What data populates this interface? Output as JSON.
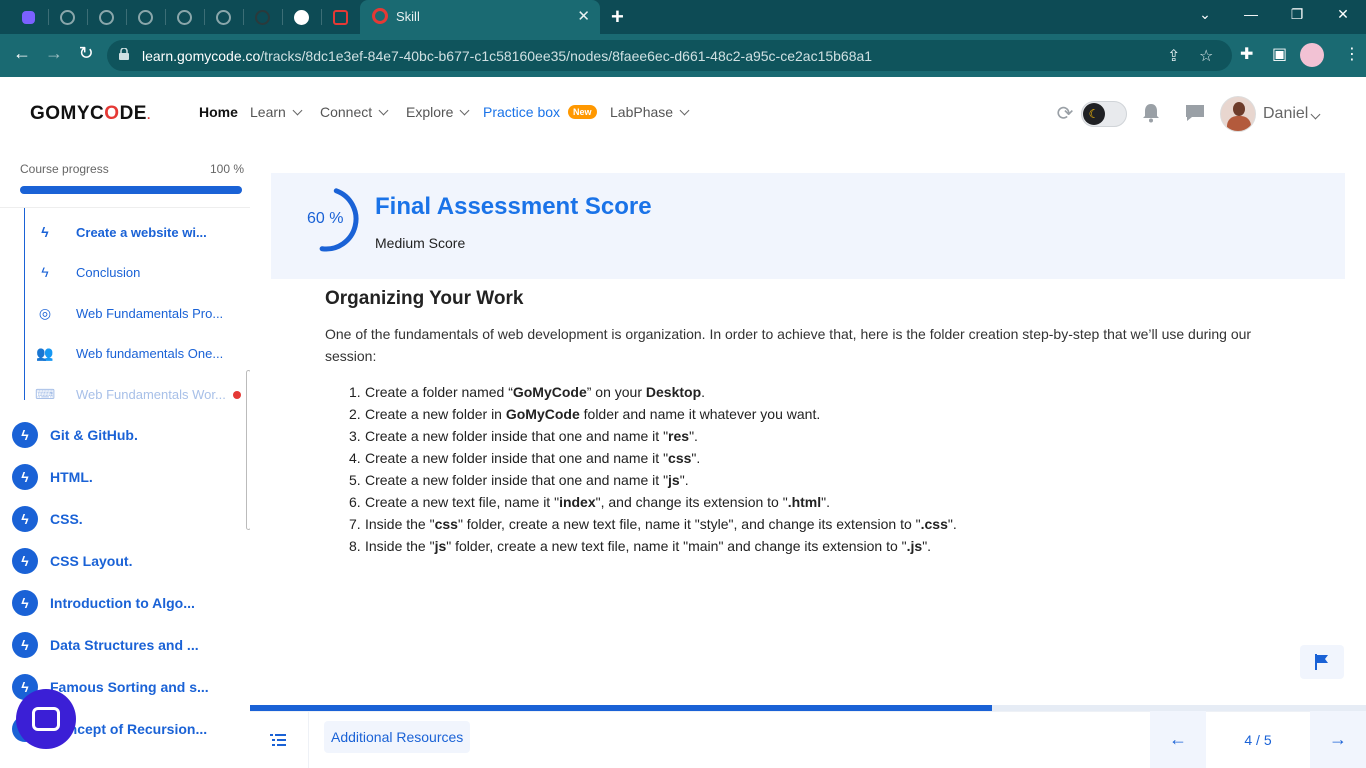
{
  "browser": {
    "tab_title": "Skill",
    "url_domain": "learn.gomycode.co",
    "url_path": "/tracks/8dc1e3ef-84e7-40bc-b677-c1c58160ee35/nodes/8faee6ec-d661-48c2-a95c-ce2ac15b68a1"
  },
  "header": {
    "logo_left": "GOMYC",
    "logo_mid": "O",
    "logo_right": "DE",
    "logo_mark": ".",
    "nav": {
      "home": "Home",
      "learn": "Learn",
      "connect": "Connect",
      "explore": "Explore",
      "practice": "Practice box",
      "practice_badge": "New",
      "labphase": "LabPhase"
    },
    "user_name": "Daniel"
  },
  "sidebar": {
    "progress_label": "Course progress",
    "progress_value": "100 %",
    "progress_fraction": 1.0,
    "sub_items": [
      {
        "label": "Create a website wi...",
        "icon": "lightning-icon"
      },
      {
        "label": "Conclusion",
        "icon": "lightning-icon"
      },
      {
        "label": "Web Fundamentals Pro...",
        "icon": "target-icon"
      },
      {
        "label": "Web fundamentals One...",
        "icon": "people-icon"
      },
      {
        "label": "Web Fundamentals Wor...",
        "icon": "workshop-icon"
      }
    ],
    "modules": [
      "Git & GitHub.",
      "HTML.",
      "CSS.",
      "CSS Layout.",
      "Introduction to Algo...",
      "Data Structures and ...",
      "Famous Sorting and s...",
      "Concept of Recursion..."
    ]
  },
  "score": {
    "percent_label": "60 %",
    "percent": 60,
    "title": "Final Assessment Score",
    "subtitle": "Medium Score"
  },
  "lesson": {
    "title": "Organizing Your Work",
    "intro": "One of the fundamentals of web development is organization. In order to achieve that, here is the folder creation step-by-step that we’ll use during our session:",
    "steps": [
      {
        "n": "1.",
        "a": "Create a folder named “",
        "b": "GoMyCode",
        "c": "” on your ",
        "d": "Desktop",
        "e": "."
      },
      {
        "n": "2.",
        "a": "Create a new folder in ",
        "b": "GoMyCode",
        "c": " folder and name it whatever you want.",
        "d": "",
        "e": ""
      },
      {
        "n": "3.",
        "a": "Create a new folder inside that one and name it \"",
        "b": "res",
        "c": "\".",
        "d": "",
        "e": ""
      },
      {
        "n": "4.",
        "a": "Create a new folder inside that one and name it \"",
        "b": "css",
        "c": "\".",
        "d": "",
        "e": ""
      },
      {
        "n": "5.",
        "a": "Create a new folder inside that one and name it \"",
        "b": "js",
        "c": "\".",
        "d": "",
        "e": ""
      },
      {
        "n": "6.",
        "a": "Create a new text file, name it \"",
        "b": "index",
        "c": "\", and change its extension to \"",
        "d": ".html",
        "e": "\"."
      },
      {
        "n": "7.",
        "a": "Inside the \"",
        "b": "css",
        "c": "\" folder, create a new text file, name it \"style\", and change its extension to \"",
        "d": ".css",
        "e": "\"."
      },
      {
        "n": "8.",
        "a": "Inside the \"",
        "b": "js",
        "c": "\" folder, create a new text file, name it \"main\" and change its extension to \"",
        "d": ".js",
        "e": "\"."
      }
    ]
  },
  "footer": {
    "resources_label": "Additional Resources",
    "page_indicator": "4 / 5",
    "lesson_progress_fraction": 0.665
  },
  "colors": {
    "accent": "#1a62d6",
    "browser_tabbar": "#0d4b55",
    "browser_toolbar": "#1a6a72",
    "score_card": "#f1f5fd",
    "new_badge": "#ff9800",
    "alert_dot": "#e53935"
  }
}
